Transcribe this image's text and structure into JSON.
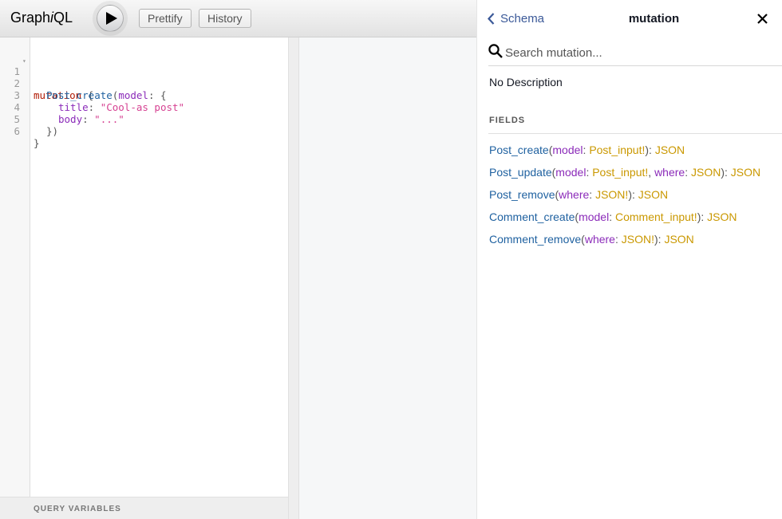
{
  "toolbar": {
    "logo_pre": "Graph",
    "logo_i": "i",
    "logo_post": "QL",
    "prettify_label": "Prettify",
    "history_label": "History"
  },
  "editor": {
    "lines": [
      {
        "n": "1",
        "fold": "▾"
      },
      {
        "n": "2"
      },
      {
        "n": "3"
      },
      {
        "n": "4"
      },
      {
        "n": "5"
      },
      {
        "n": "6"
      }
    ],
    "tokens": {
      "mutation": "mutation",
      "brace_open": " {",
      "post_create": "Post_create",
      "paren_open": "(",
      "model": "model",
      "colon_brace": ": {",
      "title": "title",
      "colon": ": ",
      "title_value": "\"Cool-as post\"",
      "body": "body",
      "body_value": "\"...\"",
      "close_inner": "})",
      "brace_close": "}"
    },
    "query_variables_label": "QUERY VARIABLES"
  },
  "docs": {
    "back_label": "Schema",
    "title": "mutation",
    "search_placeholder": "Search mutation...",
    "description": "No Description",
    "fields_label": "FIELDS",
    "fields": [
      {
        "name": "Post_create",
        "args": [
          {
            "name": "model",
            "type": "Post_input!"
          }
        ],
        "returns": "JSON"
      },
      {
        "name": "Post_update",
        "args": [
          {
            "name": "model",
            "type": "Post_input!"
          },
          {
            "name": "where",
            "type": "JSON"
          }
        ],
        "returns": "JSON"
      },
      {
        "name": "Post_remove",
        "args": [
          {
            "name": "where",
            "type": "JSON!"
          }
        ],
        "returns": "JSON"
      },
      {
        "name": "Comment_create",
        "args": [
          {
            "name": "model",
            "type": "Comment_input!"
          }
        ],
        "returns": "JSON"
      },
      {
        "name": "Comment_remove",
        "args": [
          {
            "name": "where",
            "type": "JSON!"
          }
        ],
        "returns": "JSON"
      }
    ]
  },
  "icons": {
    "execute": "play-icon",
    "back": "chevron-left-icon",
    "close": "close-icon",
    "search": "search-icon"
  }
}
